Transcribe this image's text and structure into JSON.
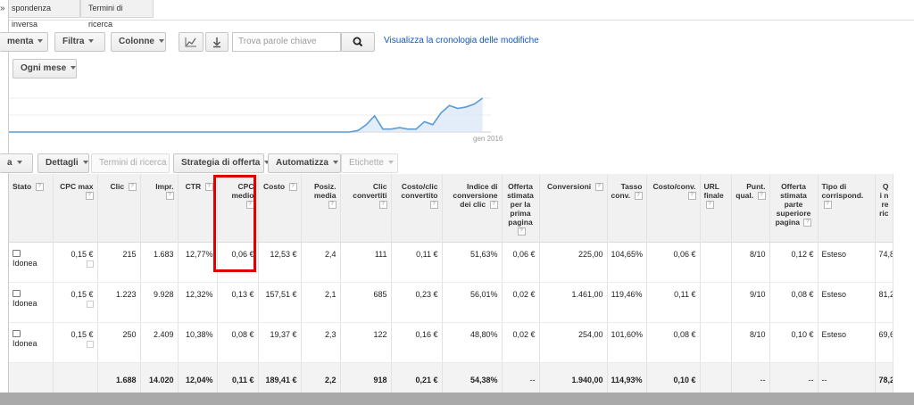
{
  "tabs": [
    "spondenza inversa",
    "Termini di ricerca"
  ],
  "collapse_glyph": "»",
  "toolbar": {
    "segment_label": "menta",
    "filter_label": "Filtra",
    "columns_label": "Colonne",
    "search_placeholder": "Trova parole chiave",
    "history_link": "Visualizza la cronologia delle modifiche",
    "period_label": "Ogni mese"
  },
  "chart_data": {
    "type": "line",
    "x_label_visible": "gen 2016",
    "series_color": "#5b9bd5",
    "values": [
      0,
      0,
      0,
      0,
      0,
      0,
      0,
      0,
      0,
      0,
      0,
      0,
      0,
      0,
      0,
      0,
      0,
      0,
      0,
      0,
      0,
      0,
      0,
      0,
      0,
      0,
      0,
      0,
      0,
      0,
      0,
      0,
      0,
      0,
      0,
      0,
      0,
      0,
      0,
      0,
      0,
      0,
      2,
      10,
      22,
      4,
      4,
      6,
      4,
      4,
      14,
      10,
      26,
      36,
      32,
      34,
      38,
      46,
      0
    ]
  },
  "actions": {
    "modify_label": "a",
    "details_label": "Dettagli",
    "search_terms_label": "Termini di ricerca",
    "bid_strategy_label": "Strategia di offerta",
    "automate_label": "Automatizza",
    "labels_label": "Etichette"
  },
  "columns": [
    "Stato",
    "CPC max",
    "Clic",
    "Impr.",
    "CTR",
    "CPC medio",
    "Costo",
    "Posiz. media",
    "Clic convertiti",
    "Costo/clic convertito",
    "Indice di conversione dei clic",
    "Offerta stimata per la prima pagina",
    "Conversioni",
    "Tasso conv.",
    "Costo/conv.",
    "URL finale",
    "Punt. qual.",
    "Offerta stimata parte superiore pagina",
    "Tipo di corrispond.",
    "Q i n re ric"
  ],
  "rows": [
    [
      "Idonea",
      "0,15 €",
      "215",
      "1.683",
      "12,77%",
      "0,06 €",
      "12,53 €",
      "2,4",
      "111",
      "0,11 €",
      "51,63%",
      "0,06 €",
      "225,00",
      "104,65%",
      "0,06 €",
      "",
      "8/10",
      "0,12 €",
      "Esteso",
      "74,8"
    ],
    [
      "Idonea",
      "0,15 €",
      "1.223",
      "9.928",
      "12,32%",
      "0,13 €",
      "157,51 €",
      "2,1",
      "685",
      "0,23 €",
      "56,01%",
      "0,02 €",
      "1.461,00",
      "119,46%",
      "0,11 €",
      "",
      "9/10",
      "0,08 €",
      "Esteso",
      "81,2"
    ],
    [
      "Idonea",
      "0,15 €",
      "250",
      "2.409",
      "10,38%",
      "0,08 €",
      "19,37 €",
      "2,3",
      "122",
      "0,16 €",
      "48,80%",
      "0,02 €",
      "254,00",
      "101,60%",
      "0,08 €",
      "",
      "8/10",
      "0,10 €",
      "Esteso",
      "69,6"
    ]
  ],
  "totals": [
    "",
    "",
    "1.688",
    "14.020",
    "12,04%",
    "0,11 €",
    "189,41 €",
    "2,2",
    "918",
    "0,21 €",
    "54,38%",
    "--",
    "1.940,00",
    "114,93%",
    "0,10 €",
    "",
    "--",
    "--",
    "--",
    "78,2"
  ],
  "highlight_color": "#e00000"
}
